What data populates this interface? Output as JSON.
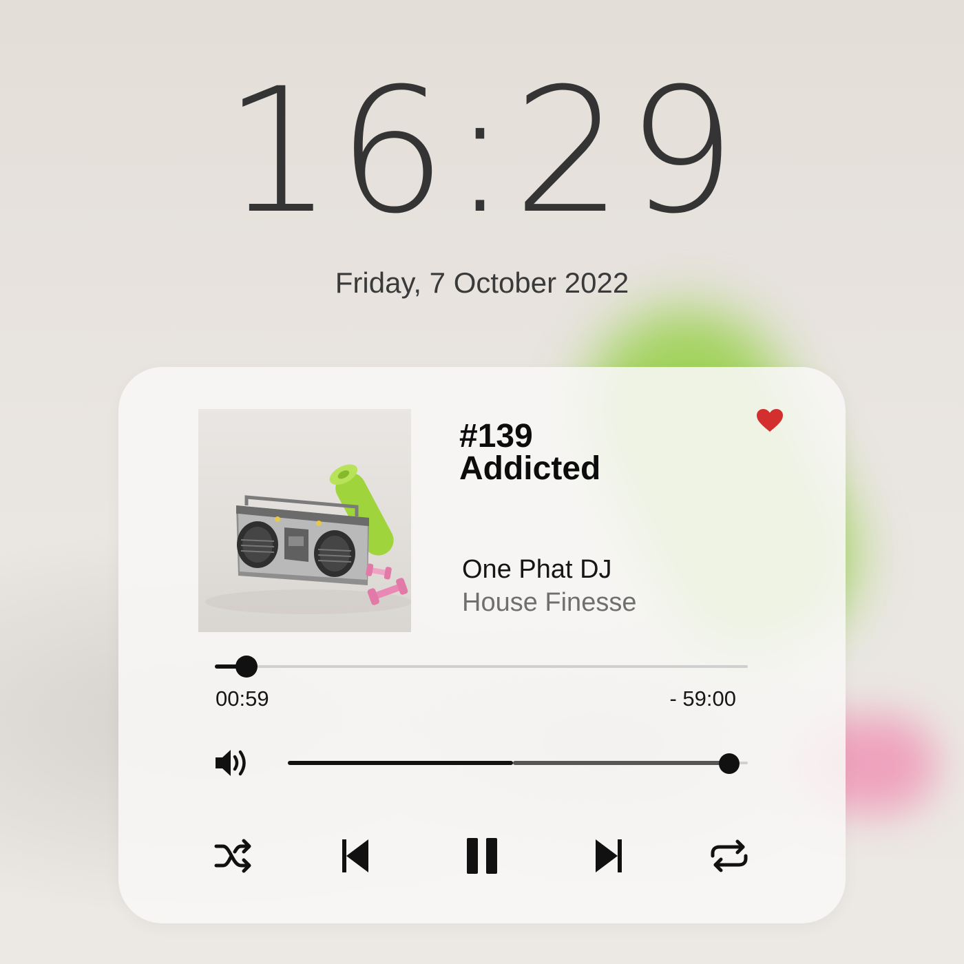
{
  "lock_screen": {
    "time": "16:29",
    "date": "Friday, 7 October 2022"
  },
  "player": {
    "episode": "#139",
    "title": "Addicted",
    "artist": "One Phat DJ",
    "album": "House Finesse",
    "liked": true,
    "progress": {
      "elapsed": "00:59",
      "remaining": "- 59:00",
      "fraction": 0.06
    },
    "volume": {
      "level": 0.96,
      "secondary_level": 0.49
    },
    "controls": [
      "shuffle-icon",
      "previous-icon",
      "pause-icon",
      "next-icon",
      "repeat-icon"
    ]
  },
  "colors": {
    "accent_heart": "#d32f2f",
    "text_primary": "#0c0c0c",
    "text_secondary": "#6f6f6f",
    "clock": "#343434"
  }
}
